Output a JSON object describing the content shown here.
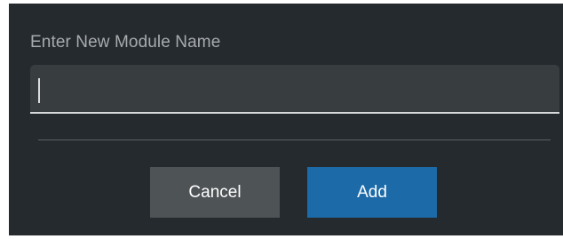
{
  "dialog": {
    "prompt": "Enter New Module Name",
    "input_value": "",
    "buttons": {
      "cancel": "Cancel",
      "add": "Add"
    }
  },
  "colors": {
    "background": "#252a2e",
    "input_background": "#383d40",
    "cancel_button": "#4e5356",
    "add_button": "#1c6aa8"
  }
}
